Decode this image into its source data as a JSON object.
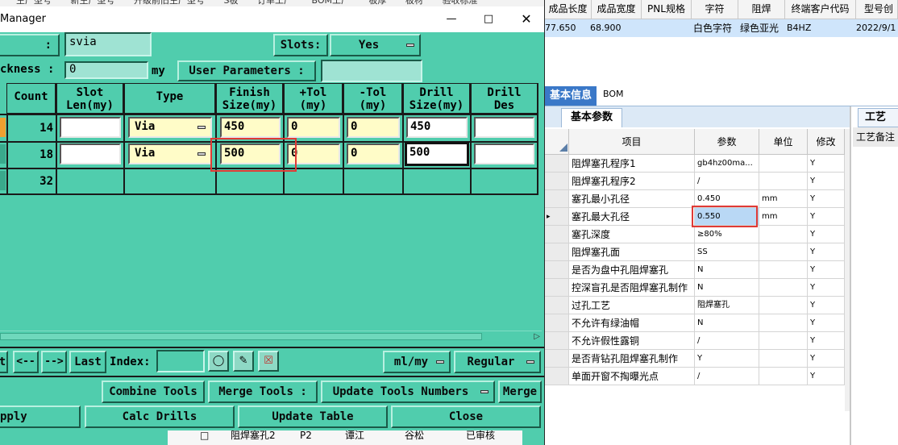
{
  "tool_manager": {
    "title": "Manager",
    "top_strip": [
      "生产型号",
      "新生产型号",
      "升级前旧生产型号",
      "S板",
      "订单工厂",
      "BOM工厂",
      "板厚",
      "板材",
      "验收标准"
    ],
    "field_left": ":",
    "job_name": "svia",
    "slots_label": "Slots:",
    "slots_value": "Yes",
    "thickness_label": "ckness :",
    "thickness_value": "0",
    "thickness_unit": "my",
    "user_params_label": "User Parameters :",
    "user_params_value": "",
    "columns": [
      "Count",
      "Slot\nLen(my)",
      "Type",
      "Finish\nSize(my)",
      "+Tol\n(my)",
      "-Tol\n(my)",
      "Drill\nSize(my)",
      "Drill\nDes"
    ],
    "rows": [
      {
        "count": "14",
        "slot_len": "",
        "type": "Via",
        "finish": "450",
        "plus_tol": "0",
        "minus_tol": "0",
        "drill": "450",
        "des": ""
      },
      {
        "count": "18",
        "slot_len": "",
        "type": "Via",
        "finish": "500",
        "plus_tol": "0",
        "minus_tol": "0",
        "drill": "500",
        "des": ""
      },
      {
        "count": "32"
      }
    ],
    "nav": {
      "first": "t",
      "prev": "<--",
      "next": "-->",
      "last": "Last",
      "index_label": "Index:",
      "index_value": ""
    },
    "units_select": "ml/my",
    "mode_select": "Regular",
    "buttons": {
      "combine": "Combine Tools",
      "merge_label": "Merge Tools :",
      "update_numbers": "Update Tools Numbers",
      "merge": "Merge",
      "apply": "pply",
      "calc": "Calc Drills",
      "update_table": "Update Table",
      "close": "Close"
    },
    "bottom_strip": {
      "a": "阻焊塞孔2",
      "b": "P2",
      "c": "谭江",
      "d": "谷松",
      "e": "已审核"
    }
  },
  "right_panel": {
    "headers": [
      "成品长度",
      "成品宽度",
      "PNL规格",
      "字符",
      "阻焊",
      "终端客户代码",
      "型号创"
    ],
    "row": {
      "length": "77.650",
      "width": "68.900",
      "char": "白色字符",
      "solder": "绿色亚光",
      "code": "B4HZ",
      "date": "2022/9/1"
    },
    "tabs": {
      "basic": "基本信息",
      "bom": "BOM"
    },
    "subtab": "基本参数",
    "side_tab": "工艺",
    "side_label": "工艺备注",
    "param_headers": {
      "item": "项目",
      "param": "参数",
      "unit": "单位",
      "modify": "修改"
    },
    "params": [
      {
        "item": "阻焊塞孔程序1",
        "value": "gb4hz00ma...",
        "unit": "",
        "mod": "Y"
      },
      {
        "item": "阻焊塞孔程序2",
        "value": "/",
        "unit": "",
        "mod": "Y"
      },
      {
        "item": "塞孔最小孔径",
        "value": "0.450",
        "unit": "mm",
        "mod": "Y"
      },
      {
        "item": "塞孔最大孔径",
        "value": "0.550",
        "unit": "mm",
        "mod": "Y"
      },
      {
        "item": "塞孔深度",
        "value": "≥80%",
        "unit": "",
        "mod": "Y"
      },
      {
        "item": "阻焊塞孔面",
        "value": "SS",
        "unit": "",
        "mod": "Y"
      },
      {
        "item": "是否为盘中孔阻焊塞孔",
        "value": "N",
        "unit": "",
        "mod": "Y"
      },
      {
        "item": "控深盲孔是否阻焊塞孔制作",
        "value": "N",
        "unit": "",
        "mod": "Y"
      },
      {
        "item": "过孔工艺",
        "value": "阻焊塞孔",
        "unit": "",
        "mod": "Y"
      },
      {
        "item": "不允许有绿油帽",
        "value": "N",
        "unit": "",
        "mod": "Y"
      },
      {
        "item": "不允许假性露铜",
        "value": "/",
        "unit": "",
        "mod": "Y"
      },
      {
        "item": "是否背钻孔阻焊塞孔制作",
        "value": "Y",
        "unit": "",
        "mod": "Y"
      },
      {
        "item": "单面开窗不掏曝光点",
        "value": "/",
        "unit": "",
        "mod": "Y"
      }
    ]
  }
}
